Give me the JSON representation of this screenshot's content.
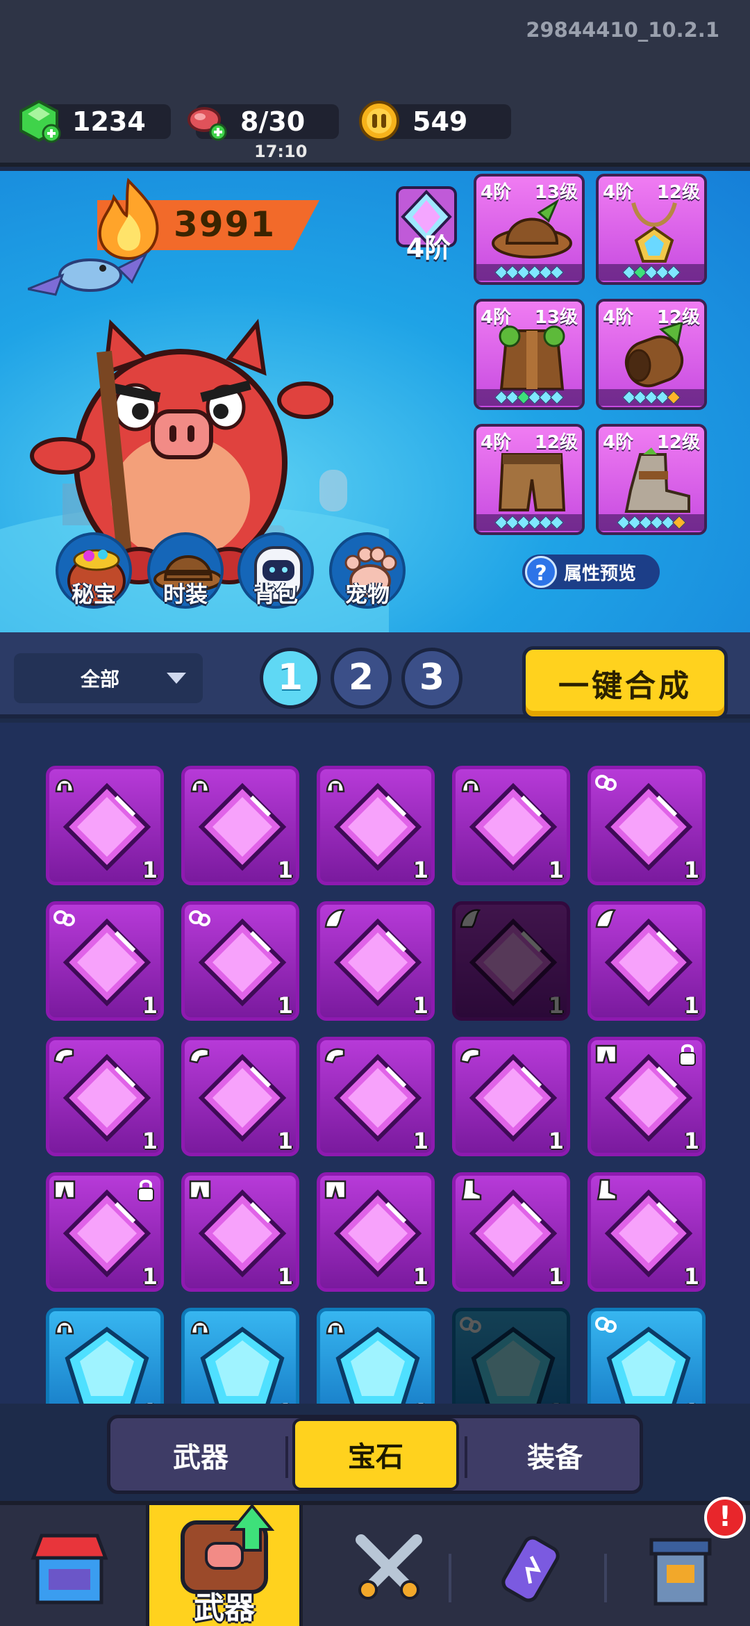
{
  "version": "29844410_10.2.1",
  "resources": {
    "gems": "1234",
    "stamina": "8/30",
    "stamina_timer": "17:10",
    "coins": "549"
  },
  "hero": {
    "power": "3991",
    "tier_label": "4阶",
    "attr_preview_label": "属性预览",
    "quick_buttons": [
      "秘宝",
      "时装",
      "背包",
      "宠物"
    ],
    "equipment": [
      {
        "tier": "4阶",
        "level": "13级",
        "item": "hat-icon",
        "stars": [
          "c",
          "c",
          "c",
          "c",
          "c",
          "c"
        ]
      },
      {
        "tier": "4阶",
        "level": "12级",
        "item": "amulet-icon",
        "stars": [
          "c",
          "g",
          "c",
          "c",
          "c"
        ]
      },
      {
        "tier": "4阶",
        "level": "13级",
        "item": "armor-icon",
        "stars": [
          "c",
          "c",
          "g",
          "c",
          "c",
          "c"
        ]
      },
      {
        "tier": "4阶",
        "level": "12级",
        "item": "bracer-icon",
        "stars": [
          "c",
          "c",
          "c",
          "c",
          "o"
        ]
      },
      {
        "tier": "4阶",
        "level": "12级",
        "item": "pants-icon",
        "stars": [
          "c",
          "c",
          "c",
          "c",
          "c",
          "c"
        ]
      },
      {
        "tier": "4阶",
        "level": "12级",
        "item": "boots-icon",
        "stars": [
          "c",
          "c",
          "c",
          "c",
          "c",
          "o"
        ]
      }
    ]
  },
  "filter": {
    "dropdown_value": "全部",
    "pages": [
      "1",
      "2",
      "3"
    ],
    "active_page": "1",
    "merge_label": "一键合成"
  },
  "gems": [
    {
      "color": "purple",
      "slot": "helmet-icon",
      "count": "1",
      "dim": false,
      "locked": false
    },
    {
      "color": "purple",
      "slot": "helmet-icon",
      "count": "1",
      "dim": false,
      "locked": false
    },
    {
      "color": "purple",
      "slot": "helmet-icon",
      "count": "1",
      "dim": false,
      "locked": false
    },
    {
      "color": "purple",
      "slot": "helmet-icon",
      "count": "1",
      "dim": false,
      "locked": false
    },
    {
      "color": "purple",
      "slot": "necklace-icon",
      "count": "1",
      "dim": false,
      "locked": false
    },
    {
      "color": "purple",
      "slot": "necklace-icon",
      "count": "1",
      "dim": false,
      "locked": false
    },
    {
      "color": "purple",
      "slot": "necklace-icon",
      "count": "1",
      "dim": false,
      "locked": false
    },
    {
      "color": "purple",
      "slot": "wing-icon",
      "count": "1",
      "dim": false,
      "locked": false
    },
    {
      "color": "purple",
      "slot": "wing-icon",
      "count": "1",
      "dim": true,
      "locked": false
    },
    {
      "color": "purple",
      "slot": "wing-icon",
      "count": "1",
      "dim": false,
      "locked": false
    },
    {
      "color": "purple",
      "slot": "glove-icon",
      "count": "1",
      "dim": false,
      "locked": false
    },
    {
      "color": "purple",
      "slot": "glove-icon",
      "count": "1",
      "dim": false,
      "locked": false
    },
    {
      "color": "purple",
      "slot": "glove-icon",
      "count": "1",
      "dim": false,
      "locked": false
    },
    {
      "color": "purple",
      "slot": "glove-icon",
      "count": "1",
      "dim": false,
      "locked": false
    },
    {
      "color": "purple",
      "slot": "pants-icon",
      "count": "1",
      "dim": false,
      "locked": true
    },
    {
      "color": "purple",
      "slot": "pants-icon",
      "count": "1",
      "dim": false,
      "locked": true
    },
    {
      "color": "purple",
      "slot": "pants-icon",
      "count": "1",
      "dim": false,
      "locked": false
    },
    {
      "color": "purple",
      "slot": "pants-icon",
      "count": "1",
      "dim": false,
      "locked": false
    },
    {
      "color": "purple",
      "slot": "boot-icon",
      "count": "1",
      "dim": false,
      "locked": false
    },
    {
      "color": "purple",
      "slot": "boot-icon",
      "count": "1",
      "dim": false,
      "locked": false
    },
    {
      "color": "cyan",
      "slot": "helmet-icon",
      "count": "1",
      "dim": false,
      "locked": false
    },
    {
      "color": "cyan",
      "slot": "helmet-icon",
      "count": "1",
      "dim": false,
      "locked": false
    },
    {
      "color": "cyan",
      "slot": "helmet-icon",
      "count": "1",
      "dim": false,
      "locked": false
    },
    {
      "color": "cyan",
      "slot": "necklace-icon",
      "count": "1",
      "dim": true,
      "locked": false
    },
    {
      "color": "cyan",
      "slot": "necklace-icon",
      "count": "1",
      "dim": false,
      "locked": false
    }
  ],
  "sub_tabs": [
    "武器",
    "宝石",
    "装备"
  ],
  "active_sub_tab": "宝石",
  "nav": {
    "active_label": "武器",
    "has_alert": true,
    "alert_text": "!"
  },
  "colors": {
    "accent_yellow": "#ffd21e",
    "gem_purple": "#b73ad8",
    "gem_cyan": "#37b6f0",
    "sky_blue": "#1fa3e6"
  }
}
